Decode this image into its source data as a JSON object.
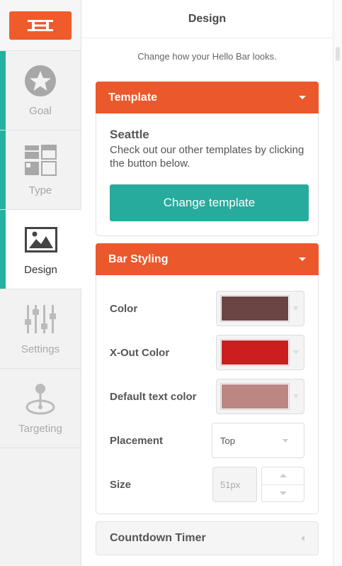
{
  "sidebar": {
    "logo": {
      "icon": "hello-bar-logo",
      "color": "#ef5b2a"
    },
    "items": [
      {
        "label": "Goal",
        "icon": "star-icon",
        "state": "done"
      },
      {
        "label": "Type",
        "icon": "layout-icon",
        "state": "done"
      },
      {
        "label": "Design",
        "icon": "image-icon",
        "state": "active"
      },
      {
        "label": "Settings",
        "icon": "sliders-icon",
        "state": "disabled"
      },
      {
        "label": "Targeting",
        "icon": "target-pin-icon",
        "state": "disabled"
      }
    ],
    "accent_color": "#26b0a0"
  },
  "header": {
    "title": "Design"
  },
  "subtitle": "Change how your Hello Bar looks.",
  "template_panel": {
    "title": "Template",
    "name": "Seattle",
    "description": "Check out our other templates by clicking the button below.",
    "button_label": "Change template",
    "header_color": "#eb582b",
    "button_color": "#26ab9c"
  },
  "styling_panel": {
    "title": "Bar Styling",
    "color_label": "Color",
    "color_value": "#6b4544",
    "xout_label": "X-Out Color",
    "xout_value": "#cc1e1e",
    "text_color_label": "Default text color",
    "text_color_value": "#bc8683",
    "placement_label": "Placement",
    "placement_value": "Top",
    "size_label": "Size",
    "size_value": "51px"
  },
  "countdown_panel": {
    "title": "Countdown Timer"
  }
}
